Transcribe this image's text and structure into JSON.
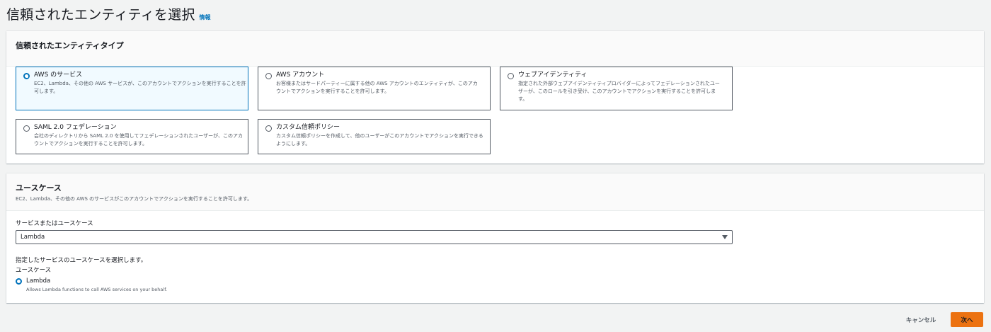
{
  "page": {
    "title": "信頼されたエンティティを選択",
    "info_link": "情報"
  },
  "entity_type": {
    "heading": "信頼されたエンティティタイプ",
    "options": [
      {
        "title": "AWS のサービス",
        "desc": "EC2、Lambda、その他の AWS サービスが、このアカウントでアクションを実行することを許可します。",
        "selected": true
      },
      {
        "title": "AWS アカウント",
        "desc": "お客様またはサードパーティーに属する他の AWS アカウントのエンティティが、このアカウントでアクションを実行することを許可します。",
        "selected": false
      },
      {
        "title": "ウェブアイデンティティ",
        "desc": "指定された外部ウェブアイデンティティプロバイダーによってフェデレーションされたユーザーが、このロールを引き受け、このアカウントでアクションを実行することを許可します。",
        "selected": false
      },
      {
        "title": "SAML 2.0 フェデレーション",
        "desc": "会社のディレクトリから SAML 2.0 を使用してフェデレーションされたユーザーが、このアカウントでアクションを実行することを許可します。",
        "selected": false
      },
      {
        "title": "カスタム信頼ポリシー",
        "desc": "カスタム信頼ポリシーを作成して、他のユーザーがこのアカウントでアクションを実行できるようにします。",
        "selected": false
      }
    ]
  },
  "use_case": {
    "heading": "ユースケース",
    "description": "EC2、Lambda、その他の AWS のサービスがこのアカウントでアクションを実行することを許可します。",
    "service_label": "サービスまたはユースケース",
    "service_value": "Lambda",
    "choose_label": "指定したサービスのユースケースを選択します。",
    "use_case_label": "ユースケース",
    "selected_option": {
      "title": "Lambda",
      "desc": "Allows Lambda functions to call AWS services on your behalf."
    }
  },
  "footer": {
    "cancel_label": "キャンセル",
    "next_label": "次へ"
  },
  "colors": {
    "accent": "#0073bb",
    "primary_button": "#ec7211",
    "background": "#f2f3f3"
  }
}
